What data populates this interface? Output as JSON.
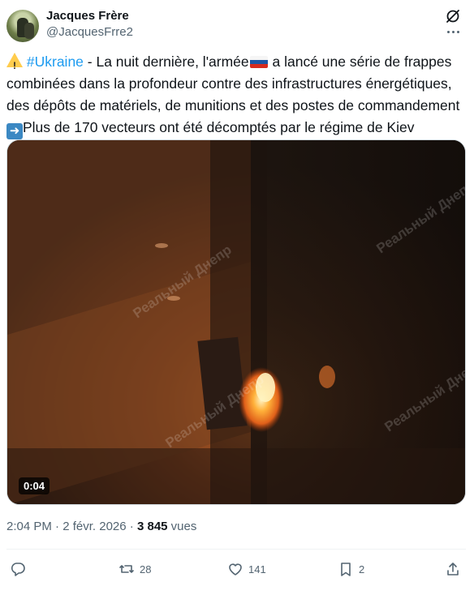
{
  "author": {
    "name": "Jacques Frère",
    "handle": "@JacquesFrre2"
  },
  "header_icons": [
    "grok-icon",
    "more-icon"
  ],
  "tweet": {
    "hashtag": "#Ukraine",
    "line1_after_hashtag": " - La nuit dernière, l'armée",
    "line1_after_flag": " a lancé une série de frappes combinées dans la profondeur contre des infrastructures énergétiques, des dépôts de matériels, de munitions et des postes de commandement",
    "line2": "Plus de 170 vecteurs ont été décomptés par le régime de Kiev"
  },
  "media": {
    "duration": "0:04",
    "watermark": "Реальный Днепр"
  },
  "meta": {
    "time": "2:04 PM",
    "separator": " · ",
    "date": "2 févr. 2026",
    "views_count": "3 845",
    "views_label": " vues"
  },
  "actions": {
    "reply_count": "",
    "retweet_count": "28",
    "like_count": "141",
    "bookmark_count": "2"
  },
  "colors": {
    "link": "#1d9bf0",
    "secondary_text": "#536471",
    "primary_text": "#0f1419"
  }
}
